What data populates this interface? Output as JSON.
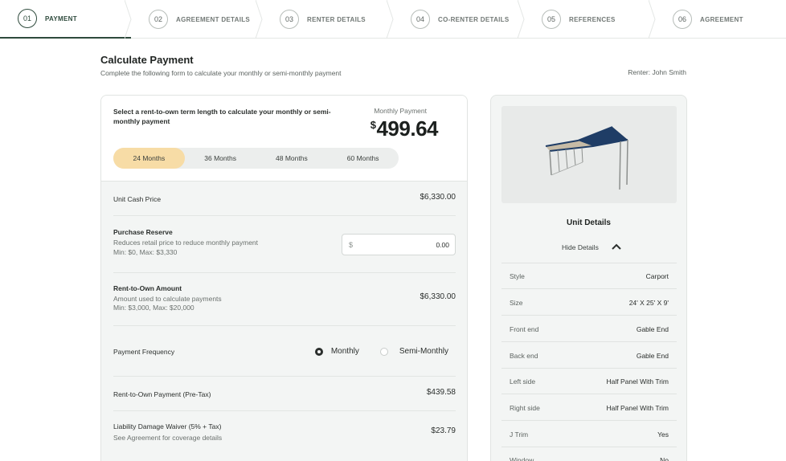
{
  "steps": [
    {
      "num": "01",
      "label": "PAYMENT",
      "active": true
    },
    {
      "num": "02",
      "label": "AGREEMENT DETAILS",
      "active": false
    },
    {
      "num": "03",
      "label": "RENTER DETAILS",
      "active": false
    },
    {
      "num": "04",
      "label": "CO-RENTER DETAILS",
      "active": false
    },
    {
      "num": "05",
      "label": "REFERENCES",
      "active": false
    },
    {
      "num": "06",
      "label": "AGREEMENT",
      "active": false
    }
  ],
  "header": {
    "title": "Calculate Payment",
    "subtitle": "Complete the following form to calculate your monthly or semi-monthly payment",
    "renter": "Renter: John Smith"
  },
  "calculator": {
    "instructions": "Select a rent-to-own term length to calculate your monthly or semi-monthly payment",
    "monthly_payment_label": "Monthly Payment",
    "currency_symbol": "$",
    "monthly_payment_value": "499.64",
    "terms": [
      "24 Months",
      "36 Months",
      "48 Months",
      "60 Months"
    ],
    "selected_term": "24 Months",
    "unit_cash_price": {
      "label": "Unit Cash Price",
      "value": "$6,330.00"
    },
    "purchase_reserve": {
      "label": "Purchase Reserve",
      "description": "Reduces retail price to reduce monthly payment",
      "limits": "Min: $0, Max: $3,330",
      "input_prefix": "$",
      "input_value": "0.00"
    },
    "rent_to_own_amount": {
      "label": "Rent-to-Own Amount",
      "description": "Amount used to calculate payments",
      "limits": "Min: $3,000, Max: $20,000",
      "value": "$6,330.00"
    },
    "payment_frequency": {
      "label": "Payment Frequency",
      "options": [
        "Monthly",
        "Semi-Monthly"
      ],
      "selected": "Monthly"
    },
    "rto_payment": {
      "label": "Rent-to-Own Payment (Pre-Tax)",
      "value": "$439.58"
    },
    "ldw": {
      "label": "Liability Damage Waiver (5% + Tax)",
      "description": "See Agreement for coverage details",
      "value": "$23.79"
    }
  },
  "unit": {
    "title": "Unit Details",
    "toggle_label": "Hide Details",
    "specs": [
      {
        "key": "Style",
        "value": "Carport"
      },
      {
        "key": "Size",
        "value": "24' X 25' X 9'"
      },
      {
        "key": "Front end",
        "value": "Gable End"
      },
      {
        "key": "Back end",
        "value": "Gable End"
      },
      {
        "key": "Left side",
        "value": "Half Panel With Trim"
      },
      {
        "key": "Right side",
        "value": "Half Panel With Trim"
      },
      {
        "key": "J Trim",
        "value": "Yes"
      },
      {
        "key": "Window",
        "value": "No"
      }
    ]
  },
  "colors": {
    "accent": "#2e4a3c",
    "selected_term_bg": "#f7dca6",
    "roof": "#1f3d66",
    "panel": "#b8ad98"
  },
  "icons": {
    "chevron": "chevron-up-icon",
    "radio_checked": "radio-checked-icon",
    "radio_unchecked": "radio-unchecked-icon"
  }
}
